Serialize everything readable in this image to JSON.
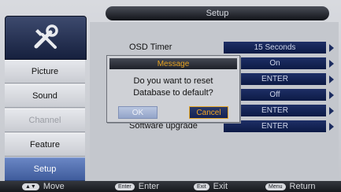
{
  "header": {
    "title": "Setup"
  },
  "sidebar": {
    "icon": "tools-icon",
    "items": [
      {
        "label": "Picture",
        "state": "normal"
      },
      {
        "label": "Sound",
        "state": "normal"
      },
      {
        "label": "Channel",
        "state": "disabled"
      },
      {
        "label": "Feature",
        "state": "normal"
      },
      {
        "label": "Setup",
        "state": "active"
      }
    ]
  },
  "settings": [
    {
      "label": "OSD Timer",
      "value": "15 Seconds"
    },
    {
      "label": "",
      "value": "On"
    },
    {
      "label": "",
      "value": "ENTER"
    },
    {
      "label": "",
      "value": "Off"
    },
    {
      "label": "",
      "value": "ENTER"
    },
    {
      "label": "Software upgrade",
      "value": "ENTER"
    }
  ],
  "dialog": {
    "title": "Message",
    "line1": "Do you want to reset",
    "line2": "Database to default?",
    "ok_label": "OK",
    "cancel_label": "Cancel",
    "focused": "Cancel"
  },
  "footer": {
    "move": {
      "key": "▲▼",
      "label": "Move"
    },
    "enter": {
      "key": "Enter",
      "label": "Enter"
    },
    "exit": {
      "key": "Exit",
      "label": "Exit"
    },
    "menu": {
      "key": "Menu",
      "label": "Return"
    }
  },
  "colors": {
    "accent": "#e6a322",
    "value_bg": "#16255a",
    "active_tab": "#5673b3"
  }
}
